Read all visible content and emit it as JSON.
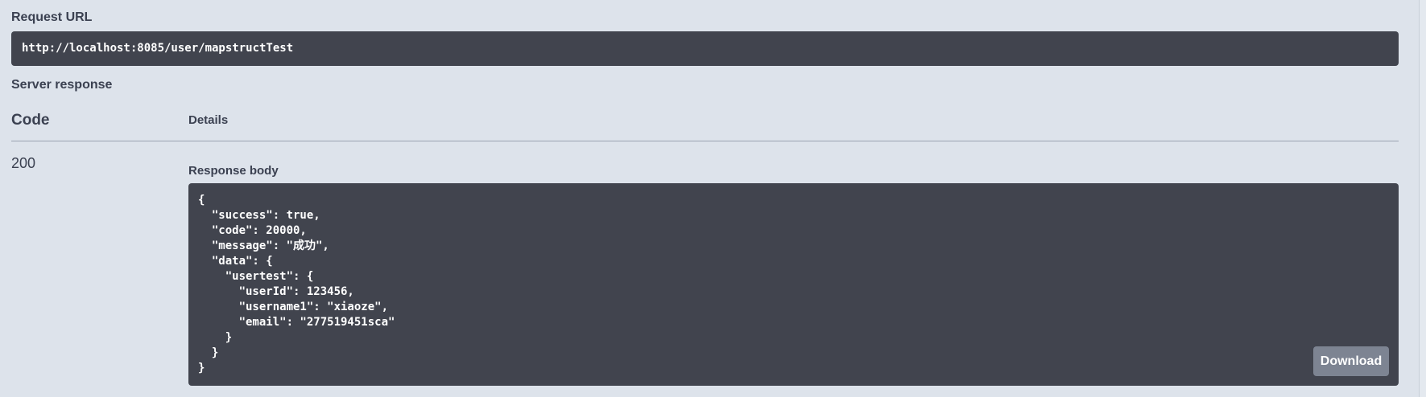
{
  "request_url": {
    "label": "Request URL",
    "value": "http://localhost:8085/user/mapstructTest"
  },
  "server_response": {
    "label": "Server response",
    "columns": {
      "code": "Code",
      "details": "Details"
    },
    "status_code": "200",
    "response_body": {
      "label": "Response body",
      "lines": [
        "{",
        "  \"success\": true,",
        "  \"code\": 20000,",
        "  \"message\": \"成功\",",
        "  \"data\": {",
        "    \"usertest\": {",
        "      \"userId\": 123456,",
        "      \"username1\": \"xiaoze\",",
        "      \"email\": \"277519451sca\"",
        "    }",
        "  }",
        "}"
      ],
      "download_label": "Download"
    }
  }
}
